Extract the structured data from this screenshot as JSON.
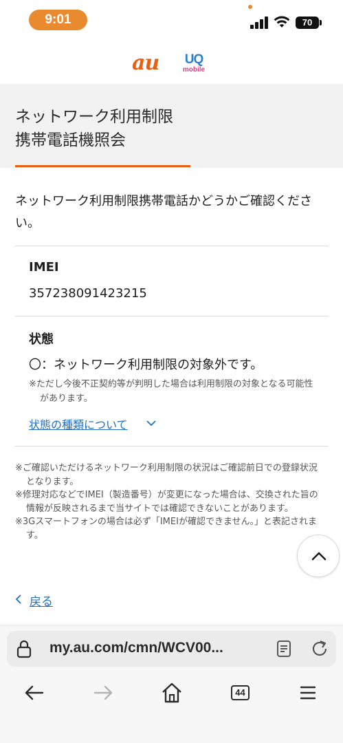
{
  "status_bar": {
    "time": "9:01",
    "battery": "70"
  },
  "brand": {
    "au": "au",
    "uq": "UQ",
    "uq_sub": "mobile"
  },
  "page": {
    "title_line1": "ネットワーク利用制限",
    "title_line2": "携帯電話機照会",
    "intro": "ネットワーク利用制限携帯電話かどうかご確認ください。"
  },
  "imei": {
    "label": "IMEI",
    "value": "357238091423215"
  },
  "status": {
    "label": "状態",
    "value": "〇：ネットワーク利用制限の対象外です。",
    "note": "※ただし今後不正契約等が判明した場合は利用制限の対象となる可能性があります。",
    "types_link": "状態の種類について"
  },
  "notes": [
    "※ご確認いただけるネットワーク利用制限の状況はご確認前日での登録状況となります。",
    "※修理対応などでIMEI（製造番号）が変更になった場合は、交換された旨の情報が反映されるまで当サイトでは確認できないことがあります。",
    "※3Gスマートフォンの場合は必ず「IMEIが確認できません。」と表記されます。"
  ],
  "back_link": "戻る",
  "browser": {
    "url": "my.au.com/cmn/WCV00...",
    "tab_count": "44"
  },
  "colors": {
    "accent": "#eb5f13",
    "link": "#1f6fc4",
    "time_pill": "#e98a2e"
  }
}
